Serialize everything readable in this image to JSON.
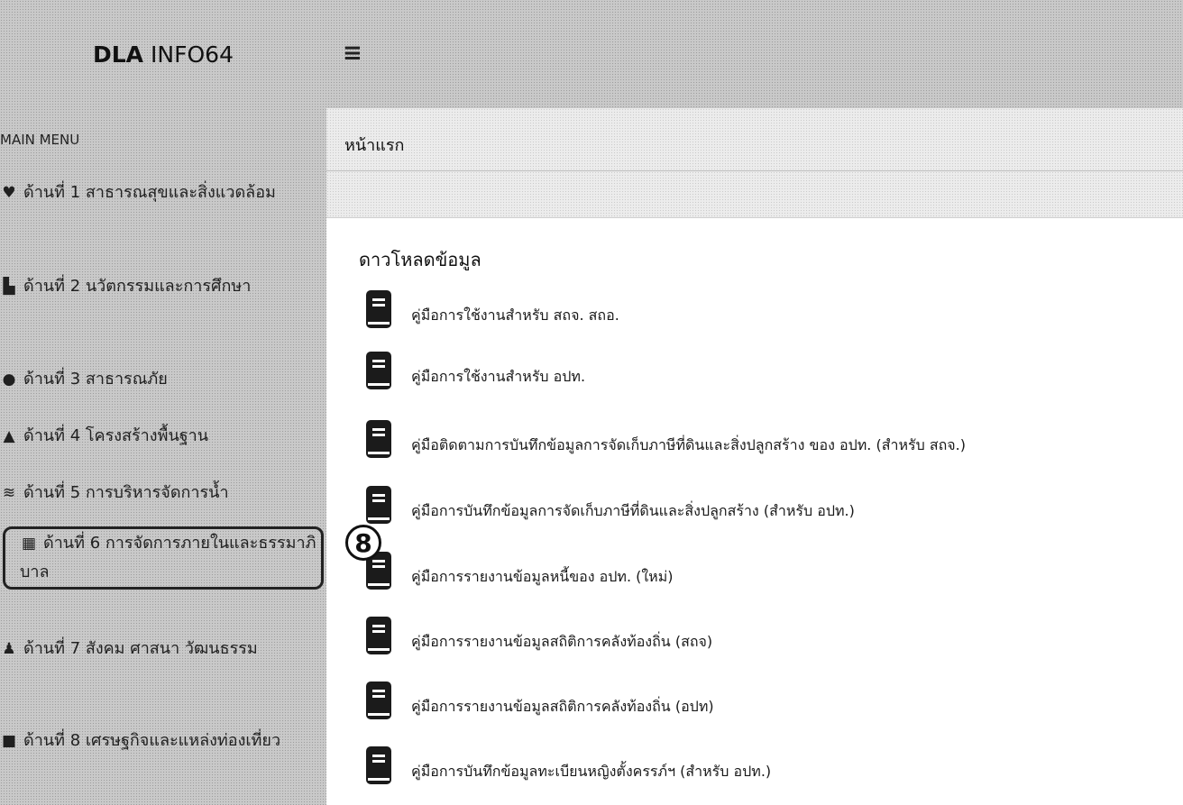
{
  "app": {
    "brand_strong": "DLA",
    "brand_rest": "INFO64",
    "menu_icon": "hamburger-icon"
  },
  "sidebar": {
    "title": "MAIN MENU",
    "items": [
      {
        "icon": "heartbeat-icon",
        "label": "ด้านที่ 1 สาธารณสุขและสิ่งแวดล้อม"
      },
      {
        "icon": "school-icon",
        "label": "ด้านที่ 2 นวัตกรรมและการศึกษา"
      },
      {
        "icon": "people-shield-icon",
        "label": "ด้านที่ 3 สาธารณภัย"
      },
      {
        "icon": "road-icon",
        "label": "ด้านที่ 4 โครงสร้างพื้นฐาน"
      },
      {
        "icon": "water-icon",
        "label": "ด้านที่ 5 การบริหารจัดการน้ำ"
      },
      {
        "icon": "building-icon",
        "label": "ด้านที่ 6 การจัดการภายในและธรรมาภิบาล"
      },
      {
        "icon": "users-icon",
        "label": "ด้านที่ 7 สังคม ศาสนา วัฒนธรรม"
      },
      {
        "icon": "money-icon",
        "label": "ด้านที่ 8 เศรษฐกิจและแหล่งท่องเที่ยว"
      }
    ]
  },
  "badge": "8",
  "page": {
    "title": "หน้าแรก",
    "section_title": "ดาวโหลดข้อมูล"
  },
  "downloads": [
    "คู่มือการใช้งานสำหรับ สถจ. สถอ.",
    "คู่มือการใช้งานสำหรับ อปท.",
    "คู่มือติดตามการบันทึกข้อมูลการจัดเก็บภาษีที่ดินและสิ่งปลูกสร้าง ของ อปท. (สำหรับ สถจ.)",
    "คู่มือการบันทึกข้อมูลการจัดเก็บภาษีที่ดินและสิ่งปลูกสร้าง (สำหรับ อปท.)",
    "คู่มือการรายงานข้อมูลหนี้ของ อปท. (ใหม่)",
    "คู่มือการรายงานข้อมูลสถิติการคลังท้องถิ่น (สถจ)",
    "คู่มือการรายงานข้อมูลสถิติการคลังท้องถิ่น (อปท)",
    "คู่มือการบันทึกข้อมูลทะเบียนหญิงตั้งครรภ์ฯ (สำหรับ อปท.)"
  ]
}
